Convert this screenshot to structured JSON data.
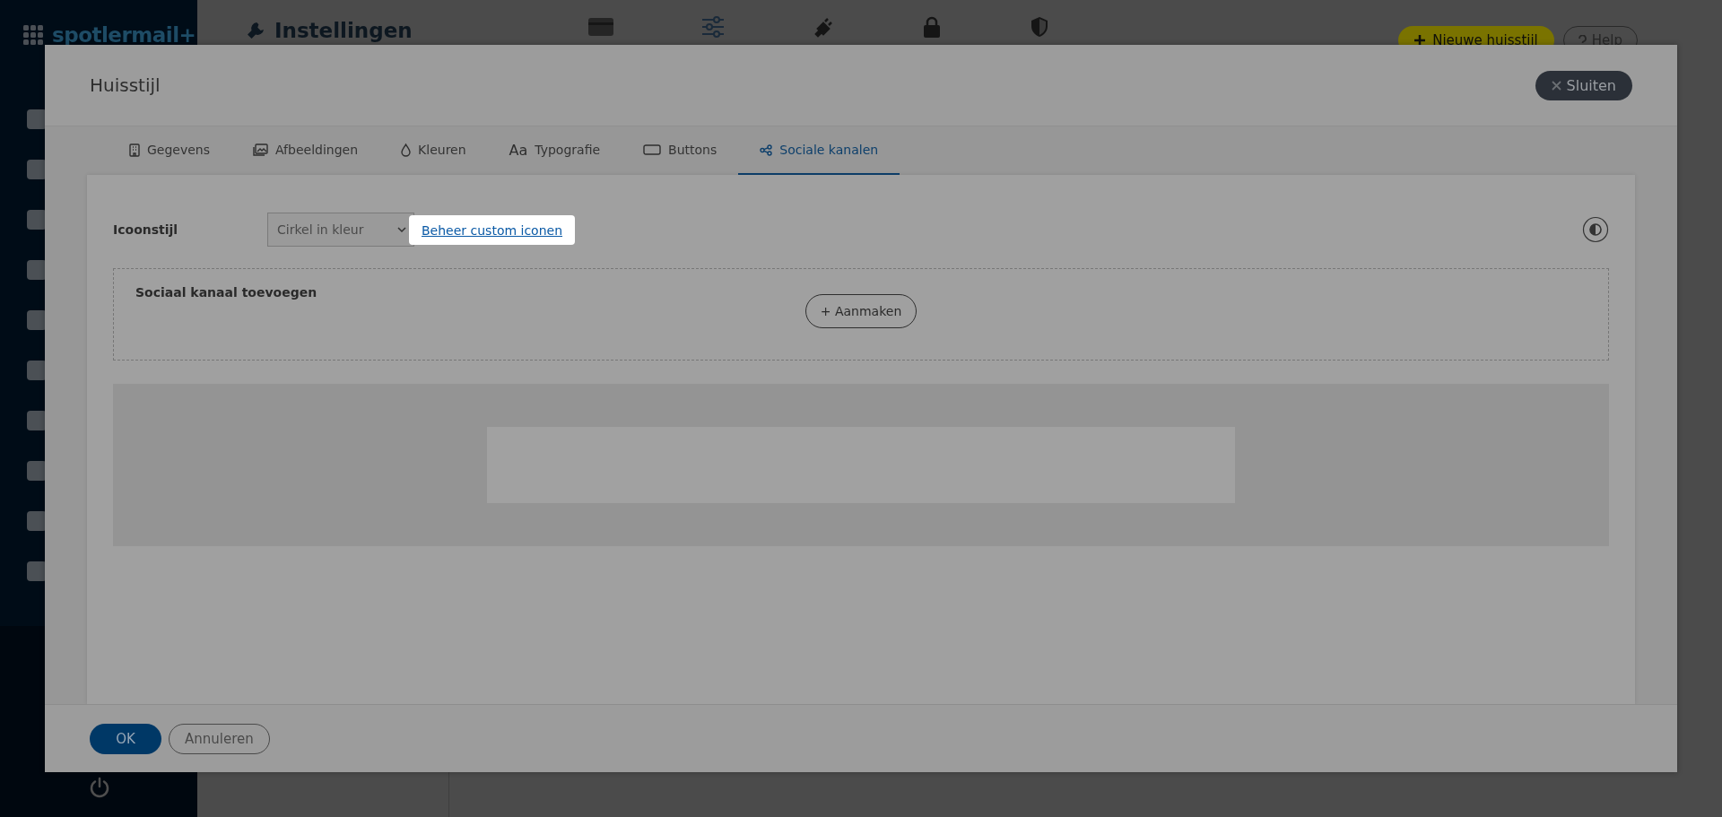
{
  "app": {
    "logo": {
      "part_1": "spotler",
      "part_2": "mail+"
    },
    "page_title": "Instellingen",
    "new_button": "Nieuwe huisstijl",
    "help_button": "Help"
  },
  "modal": {
    "title": "Huisstijl",
    "close_button": "Sluiten",
    "tabs": [
      {
        "label": "Gegevens",
        "selected": false
      },
      {
        "label": "Afbeeldingen",
        "selected": false
      },
      {
        "label": "Kleuren",
        "selected": false
      },
      {
        "label": "Typografie",
        "selected": false,
        "glyph": "Aa"
      },
      {
        "label": "Buttons",
        "selected": false
      },
      {
        "label": "Sociale kanalen",
        "selected": true
      }
    ],
    "icon_style": {
      "label": "Icoonstijl",
      "value": "Cirkel in kleur"
    },
    "manage_link": "Beheer custom iconen",
    "social_section": {
      "title": "Sociaal kanaal toevoegen",
      "create_button": "+ Aanmaken"
    },
    "ok_button": "OK",
    "cancel_button": "Annuleren"
  }
}
